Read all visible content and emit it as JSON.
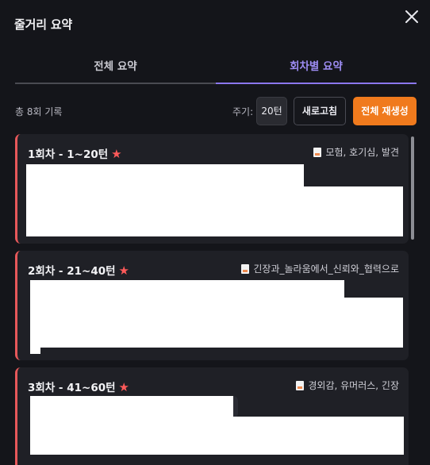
{
  "dialog": {
    "title": "줄거리 요약",
    "close_icon": "close-icon"
  },
  "tabs": [
    {
      "label": "전체 요약",
      "active": false
    },
    {
      "label": "회차별 요약",
      "active": true
    }
  ],
  "toolbar": {
    "count_text": "총 8회 기록",
    "cycle_label": "주기:",
    "cycle_value": "20턴",
    "refresh_label": "새로고침",
    "regenerate_label": "전체 재생성"
  },
  "colors": {
    "accent_purple": "#8b77ee",
    "accent_orange": "#f07a1d",
    "card_border": "#e7585a",
    "star": "#ff5a5a"
  },
  "cards": [
    {
      "title": "1회차 - 1~20턴",
      "starred": true,
      "tags": "모험, 호기심, 발견"
    },
    {
      "title": "2회차 - 21~40턴",
      "starred": true,
      "tags": "긴장과_놀라움에서_신뢰와_협력으로"
    },
    {
      "title": "3회차 - 41~60턴",
      "starred": true,
      "tags": "경외감, 유머러스, 긴장"
    }
  ]
}
